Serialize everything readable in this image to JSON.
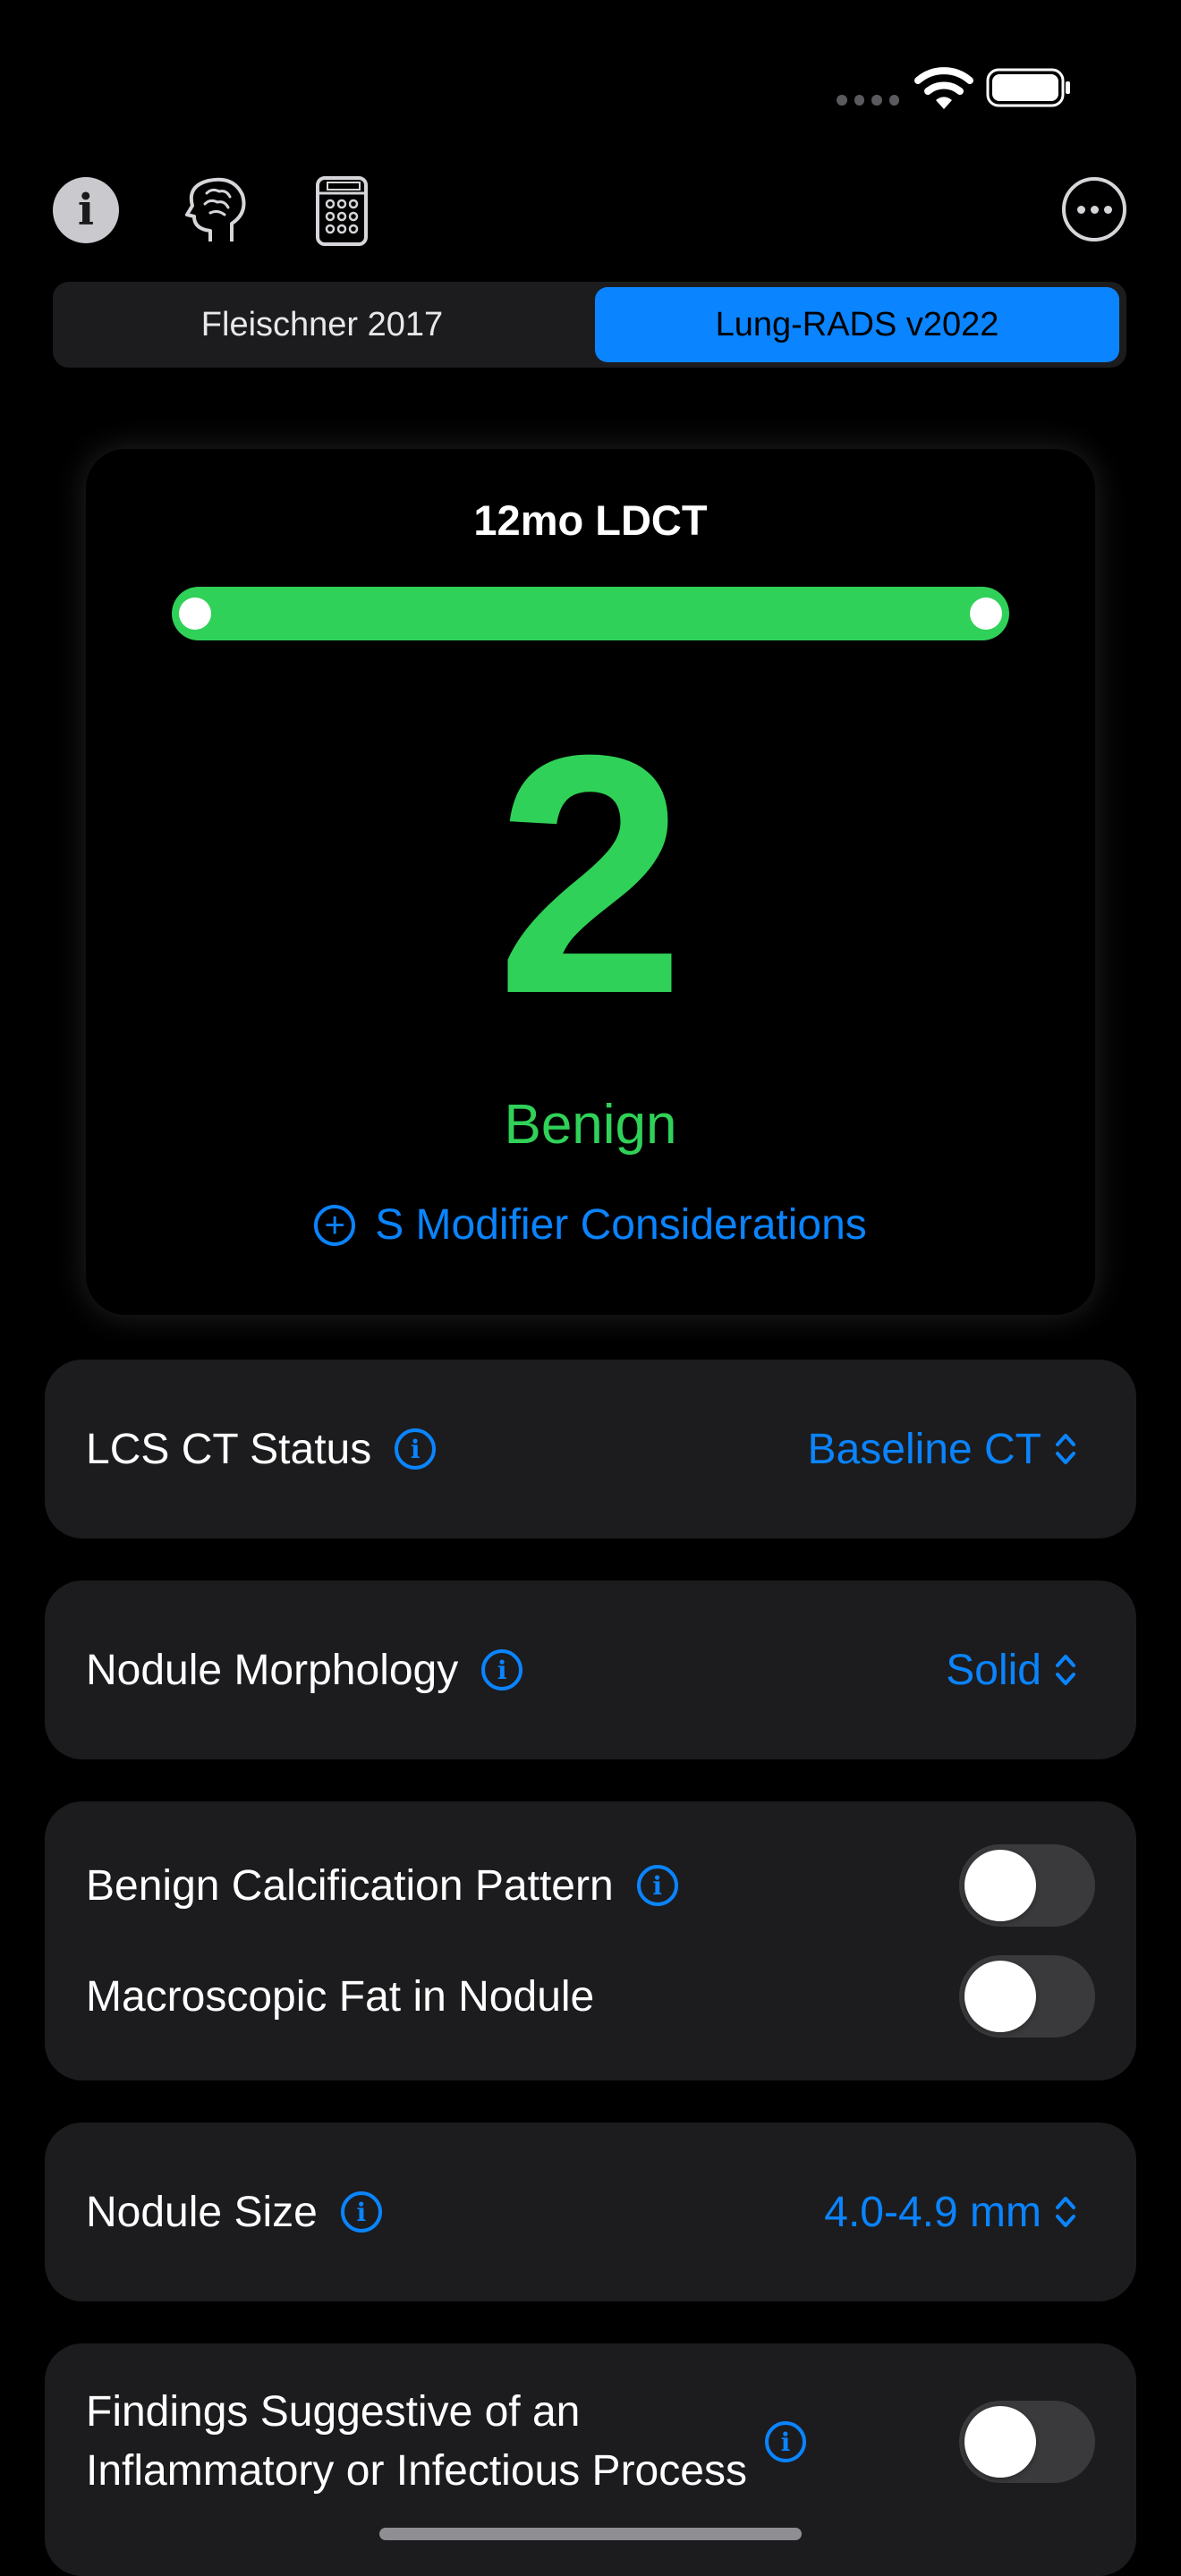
{
  "toolbar": {
    "info_glyph": "i",
    "brain_icon": "brain-icon",
    "calculator_icon": "calculator-icon",
    "more_icon": "ellipsis-circle-icon"
  },
  "tabs": [
    {
      "label": "Fleischner 2017",
      "selected": false
    },
    {
      "label": "Lung-RADS v2022",
      "selected": true
    }
  ],
  "result": {
    "recommendation": "12mo LDCT",
    "category": "2",
    "category_label": "Benign",
    "modifier_link": "S Modifier Considerations",
    "accent_color": "#30d158"
  },
  "settings": {
    "lcs_status": {
      "label": "LCS CT Status",
      "value": "Baseline CT"
    },
    "morphology": {
      "label": "Nodule Morphology",
      "value": "Solid"
    },
    "calcification": {
      "label": "Benign Calcification Pattern",
      "on": false
    },
    "fat": {
      "label": "Macroscopic Fat in Nodule",
      "on": false
    },
    "size": {
      "label": "Nodule Size",
      "value": "4.0-4.9 mm"
    },
    "inflammatory": {
      "line1": "Findings Suggestive of an",
      "line2": "Inflammatory or Infectious Process",
      "on": false
    }
  },
  "colors": {
    "background": "#000000",
    "card": "#1c1c1e",
    "accent_blue": "#0a84ff",
    "benign_green": "#30d158"
  }
}
